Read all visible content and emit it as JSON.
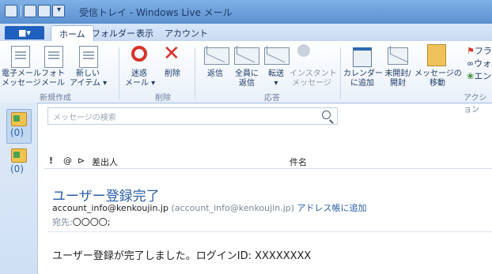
{
  "window": {
    "title": "受信トレイ - Windows Live メール",
    "title_color": "#5b90d0"
  },
  "tabs": {
    "file_label": "■▾",
    "items": [
      "ホーム",
      "フォルダー",
      "表示",
      "アカウント"
    ]
  },
  "ribbon": {
    "groups": [
      {
        "name": "新規作成",
        "buttons": [
          "電子メール\nメッセージ",
          "フォト\nメール",
          "新しい\nアイテム ▾"
        ]
      },
      {
        "name": "削除",
        "buttons": [
          "迷惑\nメール ▾",
          "削除"
        ]
      },
      {
        "name": "応答",
        "buttons": [
          "返信",
          "全員に\n返信",
          "転送\n▾",
          "インスタント\nメッセージ"
        ]
      },
      {
        "name": "アクション",
        "buttons": [
          "カレンダー\nに追加",
          "未開封/\n開封",
          "メッセージの\n移動",
          "フラ",
          "ウォ",
          "エン"
        ]
      }
    ]
  },
  "folders": {
    "counts": [
      "(0)",
      "(0)"
    ]
  },
  "search": {
    "placeholder": "メッセージの検索"
  },
  "list_header": {
    "flags": [
      "!",
      "@",
      "⊳"
    ],
    "from_label": "差出人",
    "subject_label": "件名"
  },
  "message": {
    "subject": "ユーザー登録完了",
    "sender_email": "account_info@kenkoujin.jp",
    "sender_email_paren": "(account_info@kenkoujin.jp)",
    "add_to_contacts": "アドレス帳に追加",
    "to_label": "宛先:",
    "to_value": "〇〇〇〇;",
    "body": "ユーザー登録が完了しました。ログインID: XXXXXXXX"
  }
}
